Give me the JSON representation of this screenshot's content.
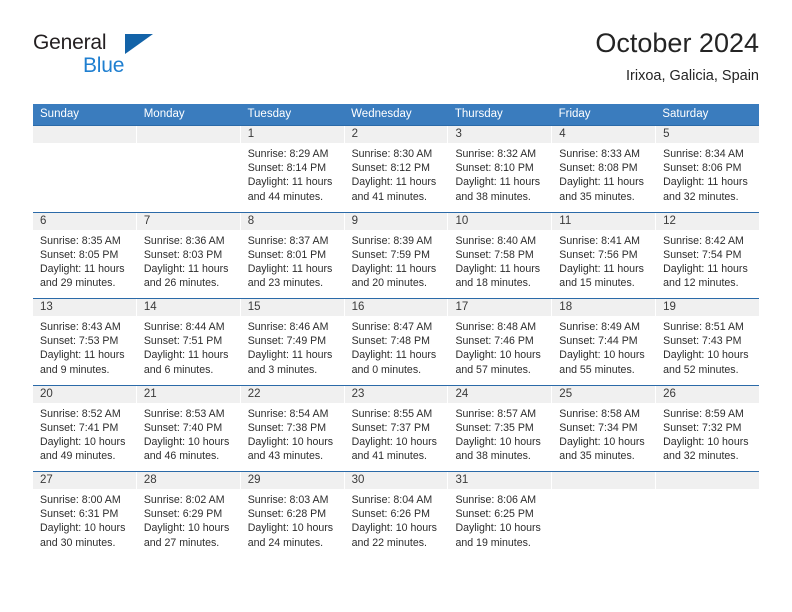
{
  "brand": {
    "line1": "General",
    "line2": "Blue",
    "flag_icon": "triangle-flag-icon",
    "color_dark": "#231f20",
    "color_blue": "#1f7fd0"
  },
  "header": {
    "title": "October 2024",
    "subtitle": "Irixoa, Galicia, Spain"
  },
  "theme": {
    "header_bar": "#3a7cbe",
    "row_divider": "#2b6aa8",
    "day_band": "#f0f0f0",
    "text": "#2d2d2d"
  },
  "weekdays": [
    "Sunday",
    "Monday",
    "Tuesday",
    "Wednesday",
    "Thursday",
    "Friday",
    "Saturday"
  ],
  "weeks": [
    [
      {
        "day": "",
        "sunrise": "",
        "sunset": "",
        "daylight1": "",
        "daylight2": ""
      },
      {
        "day": "",
        "sunrise": "",
        "sunset": "",
        "daylight1": "",
        "daylight2": ""
      },
      {
        "day": "1",
        "sunrise": "Sunrise: 8:29 AM",
        "sunset": "Sunset: 8:14 PM",
        "daylight1": "Daylight: 11 hours",
        "daylight2": "and 44 minutes."
      },
      {
        "day": "2",
        "sunrise": "Sunrise: 8:30 AM",
        "sunset": "Sunset: 8:12 PM",
        "daylight1": "Daylight: 11 hours",
        "daylight2": "and 41 minutes."
      },
      {
        "day": "3",
        "sunrise": "Sunrise: 8:32 AM",
        "sunset": "Sunset: 8:10 PM",
        "daylight1": "Daylight: 11 hours",
        "daylight2": "and 38 minutes."
      },
      {
        "day": "4",
        "sunrise": "Sunrise: 8:33 AM",
        "sunset": "Sunset: 8:08 PM",
        "daylight1": "Daylight: 11 hours",
        "daylight2": "and 35 minutes."
      },
      {
        "day": "5",
        "sunrise": "Sunrise: 8:34 AM",
        "sunset": "Sunset: 8:06 PM",
        "daylight1": "Daylight: 11 hours",
        "daylight2": "and 32 minutes."
      }
    ],
    [
      {
        "day": "6",
        "sunrise": "Sunrise: 8:35 AM",
        "sunset": "Sunset: 8:05 PM",
        "daylight1": "Daylight: 11 hours",
        "daylight2": "and 29 minutes."
      },
      {
        "day": "7",
        "sunrise": "Sunrise: 8:36 AM",
        "sunset": "Sunset: 8:03 PM",
        "daylight1": "Daylight: 11 hours",
        "daylight2": "and 26 minutes."
      },
      {
        "day": "8",
        "sunrise": "Sunrise: 8:37 AM",
        "sunset": "Sunset: 8:01 PM",
        "daylight1": "Daylight: 11 hours",
        "daylight2": "and 23 minutes."
      },
      {
        "day": "9",
        "sunrise": "Sunrise: 8:39 AM",
        "sunset": "Sunset: 7:59 PM",
        "daylight1": "Daylight: 11 hours",
        "daylight2": "and 20 minutes."
      },
      {
        "day": "10",
        "sunrise": "Sunrise: 8:40 AM",
        "sunset": "Sunset: 7:58 PM",
        "daylight1": "Daylight: 11 hours",
        "daylight2": "and 18 minutes."
      },
      {
        "day": "11",
        "sunrise": "Sunrise: 8:41 AM",
        "sunset": "Sunset: 7:56 PM",
        "daylight1": "Daylight: 11 hours",
        "daylight2": "and 15 minutes."
      },
      {
        "day": "12",
        "sunrise": "Sunrise: 8:42 AM",
        "sunset": "Sunset: 7:54 PM",
        "daylight1": "Daylight: 11 hours",
        "daylight2": "and 12 minutes."
      }
    ],
    [
      {
        "day": "13",
        "sunrise": "Sunrise: 8:43 AM",
        "sunset": "Sunset: 7:53 PM",
        "daylight1": "Daylight: 11 hours",
        "daylight2": "and 9 minutes."
      },
      {
        "day": "14",
        "sunrise": "Sunrise: 8:44 AM",
        "sunset": "Sunset: 7:51 PM",
        "daylight1": "Daylight: 11 hours",
        "daylight2": "and 6 minutes."
      },
      {
        "day": "15",
        "sunrise": "Sunrise: 8:46 AM",
        "sunset": "Sunset: 7:49 PM",
        "daylight1": "Daylight: 11 hours",
        "daylight2": "and 3 minutes."
      },
      {
        "day": "16",
        "sunrise": "Sunrise: 8:47 AM",
        "sunset": "Sunset: 7:48 PM",
        "daylight1": "Daylight: 11 hours",
        "daylight2": "and 0 minutes."
      },
      {
        "day": "17",
        "sunrise": "Sunrise: 8:48 AM",
        "sunset": "Sunset: 7:46 PM",
        "daylight1": "Daylight: 10 hours",
        "daylight2": "and 57 minutes."
      },
      {
        "day": "18",
        "sunrise": "Sunrise: 8:49 AM",
        "sunset": "Sunset: 7:44 PM",
        "daylight1": "Daylight: 10 hours",
        "daylight2": "and 55 minutes."
      },
      {
        "day": "19",
        "sunrise": "Sunrise: 8:51 AM",
        "sunset": "Sunset: 7:43 PM",
        "daylight1": "Daylight: 10 hours",
        "daylight2": "and 52 minutes."
      }
    ],
    [
      {
        "day": "20",
        "sunrise": "Sunrise: 8:52 AM",
        "sunset": "Sunset: 7:41 PM",
        "daylight1": "Daylight: 10 hours",
        "daylight2": "and 49 minutes."
      },
      {
        "day": "21",
        "sunrise": "Sunrise: 8:53 AM",
        "sunset": "Sunset: 7:40 PM",
        "daylight1": "Daylight: 10 hours",
        "daylight2": "and 46 minutes."
      },
      {
        "day": "22",
        "sunrise": "Sunrise: 8:54 AM",
        "sunset": "Sunset: 7:38 PM",
        "daylight1": "Daylight: 10 hours",
        "daylight2": "and 43 minutes."
      },
      {
        "day": "23",
        "sunrise": "Sunrise: 8:55 AM",
        "sunset": "Sunset: 7:37 PM",
        "daylight1": "Daylight: 10 hours",
        "daylight2": "and 41 minutes."
      },
      {
        "day": "24",
        "sunrise": "Sunrise: 8:57 AM",
        "sunset": "Sunset: 7:35 PM",
        "daylight1": "Daylight: 10 hours",
        "daylight2": "and 38 minutes."
      },
      {
        "day": "25",
        "sunrise": "Sunrise: 8:58 AM",
        "sunset": "Sunset: 7:34 PM",
        "daylight1": "Daylight: 10 hours",
        "daylight2": "and 35 minutes."
      },
      {
        "day": "26",
        "sunrise": "Sunrise: 8:59 AM",
        "sunset": "Sunset: 7:32 PM",
        "daylight1": "Daylight: 10 hours",
        "daylight2": "and 32 minutes."
      }
    ],
    [
      {
        "day": "27",
        "sunrise": "Sunrise: 8:00 AM",
        "sunset": "Sunset: 6:31 PM",
        "daylight1": "Daylight: 10 hours",
        "daylight2": "and 30 minutes."
      },
      {
        "day": "28",
        "sunrise": "Sunrise: 8:02 AM",
        "sunset": "Sunset: 6:29 PM",
        "daylight1": "Daylight: 10 hours",
        "daylight2": "and 27 minutes."
      },
      {
        "day": "29",
        "sunrise": "Sunrise: 8:03 AM",
        "sunset": "Sunset: 6:28 PM",
        "daylight1": "Daylight: 10 hours",
        "daylight2": "and 24 minutes."
      },
      {
        "day": "30",
        "sunrise": "Sunrise: 8:04 AM",
        "sunset": "Sunset: 6:26 PM",
        "daylight1": "Daylight: 10 hours",
        "daylight2": "and 22 minutes."
      },
      {
        "day": "31",
        "sunrise": "Sunrise: 8:06 AM",
        "sunset": "Sunset: 6:25 PM",
        "daylight1": "Daylight: 10 hours",
        "daylight2": "and 19 minutes."
      },
      {
        "day": "",
        "sunrise": "",
        "sunset": "",
        "daylight1": "",
        "daylight2": ""
      },
      {
        "day": "",
        "sunrise": "",
        "sunset": "",
        "daylight1": "",
        "daylight2": ""
      }
    ]
  ]
}
